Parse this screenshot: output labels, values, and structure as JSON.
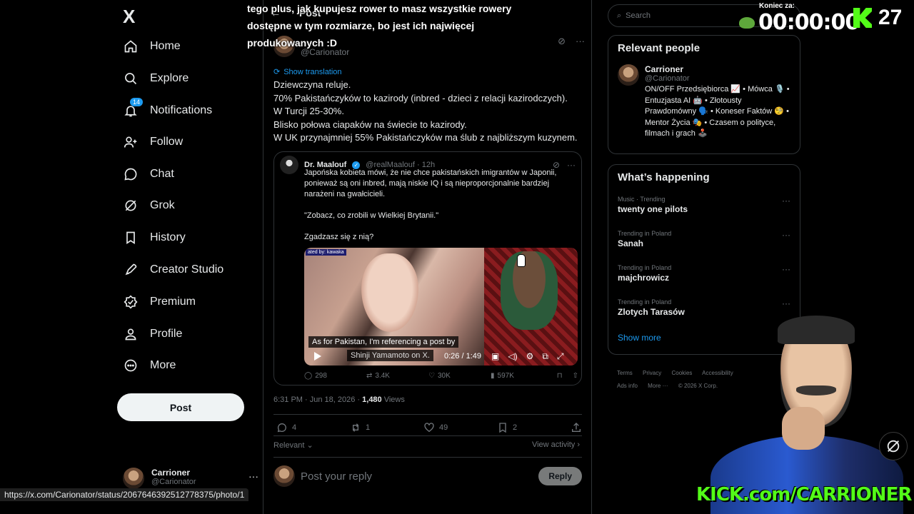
{
  "nav": {
    "logo": "X",
    "items": [
      {
        "label": "Home",
        "icon": "home-icon"
      },
      {
        "label": "Explore",
        "icon": "search-icon"
      },
      {
        "label": "Notifications",
        "icon": "bell-icon",
        "badge": "14"
      },
      {
        "label": "Follow",
        "icon": "add-person-icon"
      },
      {
        "label": "Chat",
        "icon": "chat-icon"
      },
      {
        "label": "Grok",
        "icon": "grok-icon"
      },
      {
        "label": "History",
        "icon": "bookmark-icon"
      },
      {
        "label": "Creator Studio",
        "icon": "rocket-icon"
      },
      {
        "label": "Premium",
        "icon": "verified-badge-icon"
      },
      {
        "label": "Profile",
        "icon": "person-icon"
      },
      {
        "label": "More",
        "icon": "more-circle-icon"
      }
    ],
    "post_label": "Post",
    "account": {
      "name": "Carrioner",
      "handle": "@Carionator"
    }
  },
  "header": {
    "back_label": "←",
    "title": "Post"
  },
  "overlay_text": "tego plus, jak kupujesz rower to masz wszystkie rowery dostępne w tym rozmiarze, bo jest ich najwięcej produkowanych :D",
  "tweet": {
    "author_name": "Carrioner",
    "handle": "@Carionator",
    "translate_label": "Show translation",
    "lines": [
      "Dziewczyna reluje.",
      "70% Pakistańczyków to kazirody (inbred - dzieci z relacji kazirodczych).",
      "W Turcji 25-30%.",
      "Blisko połowa ciapaków na świecie to kazirody.",
      "W UK przynajmniej 55% Pakistańczyków ma ślub z najbliższym kuzynem."
    ],
    "timestamp": "6:31 PM · Jun 18, 2026 · ",
    "views_count": "1,480",
    "views_label": " Views",
    "stats": {
      "replies": "4",
      "reposts": "1",
      "likes": "49",
      "bookmarks": "2"
    },
    "relevant_label": "Relevant ⌄",
    "view_activity_label": "View activity ›"
  },
  "quote": {
    "name": "Dr. Maalouf",
    "handle": "@realMaalouf · 12h",
    "paragraphs": [
      "Japońska kobieta mówi, że nie chce pakistańskich imigrantów w Japonii, ponieważ są oni inbred, mają niskie IQ i są nieproporcjonalnie bardziej narażeni na gwałcicieli.",
      "\"Zobacz, co zrobili w Wielkiej Brytanii.\"",
      "Zgadzasz się z nią?"
    ],
    "video": {
      "tag": "ated by: kawaka",
      "caption": "As for Pakistan, I'm referencing a post by",
      "caption2": "Shinji Yamamoto on X.",
      "time": "0:26 / 1:49"
    },
    "stats": {
      "replies": "298",
      "reposts": "3.4K",
      "likes": "30K",
      "views": "597K"
    }
  },
  "reply": {
    "placeholder": "Post your reply",
    "button": "Reply"
  },
  "right": {
    "search_placeholder": "Search",
    "relevant_title": "Relevant people",
    "person": {
      "name": "Carrioner",
      "handle": "@Carionator",
      "bio": "ON/OFF Przedsiębiorca 📈 • Mówca 🎙️ • Entuzjasta AI 🤖 • Złotousty Prawdomówny 🗣️ • Koneser Faktów 🧐 • Mentor Życia 🎭 • Czasem o polityce, filmach i grach 🕹️"
    },
    "happening_title": "What’s happening",
    "trends": [
      {
        "category": "Music · Trending",
        "name": "twenty one pilots"
      },
      {
        "category": "Trending in Poland",
        "name": "Sanah"
      },
      {
        "category": "Trending in Poland",
        "name": "majchrowicz"
      },
      {
        "category": "Trending in Poland",
        "name": "Zlotych Tarasów"
      }
    ],
    "show_more": "Show more",
    "footer": [
      "Terms",
      "Privacy",
      "Cookies",
      "Accessibility",
      "Ads info",
      "More ···",
      "© 2026 X Corp."
    ]
  },
  "stream": {
    "timer_label": "Koniec za:",
    "timer": "00:00:00",
    "kick_count": "27",
    "kick_url": "KICK.com/CARRIONER"
  },
  "status_url": "https://x.com/Carionator/status/2067646392512778375/photo/1"
}
